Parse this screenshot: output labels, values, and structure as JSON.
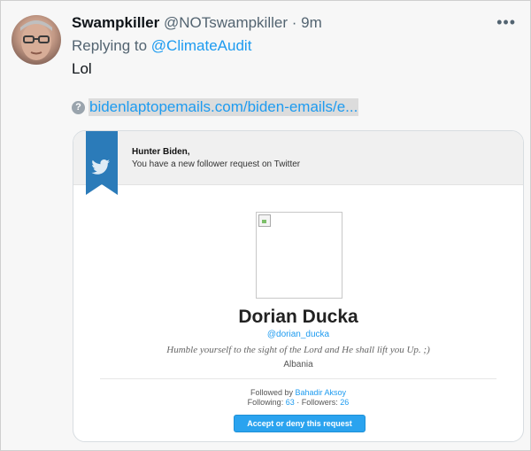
{
  "tweet": {
    "author_name": "Swampkiller",
    "author_handle": "@NOTswampkiller",
    "separator": "·",
    "time": "9m",
    "more_label": "•••",
    "replying_prefix": "Replying to",
    "replying_to": "@ClimateAudit",
    "text": "Lol",
    "link_icon": "?",
    "link_text": "bidenlaptopemails.com/biden-emails/e..."
  },
  "card": {
    "greeting": "Hunter Biden,",
    "notice": "You have a new follower request on Twitter",
    "profile": {
      "display_name": "Dorian Ducka",
      "handle": "@dorian_ducka",
      "bio": "Humble yourself to the sight of the Lord and He shall lift you Up. ;)",
      "location": "Albania"
    },
    "followed_by_label": "Followed by",
    "followed_by_name": "Bahadir Aksoy",
    "following_label": "Following:",
    "following_count": "63",
    "counts_separator": "·",
    "followers_label": "Followers:",
    "followers_count": "26",
    "action_label": "Accept or deny this request"
  },
  "colors": {
    "accent": "#1d9bf0",
    "bookmark": "#2b7bb9",
    "button": "#2aa3ef"
  },
  "icons": {
    "more": "more-horizontal-icon",
    "link": "question-mark-icon",
    "bookmark": "twitter-bird-icon"
  }
}
